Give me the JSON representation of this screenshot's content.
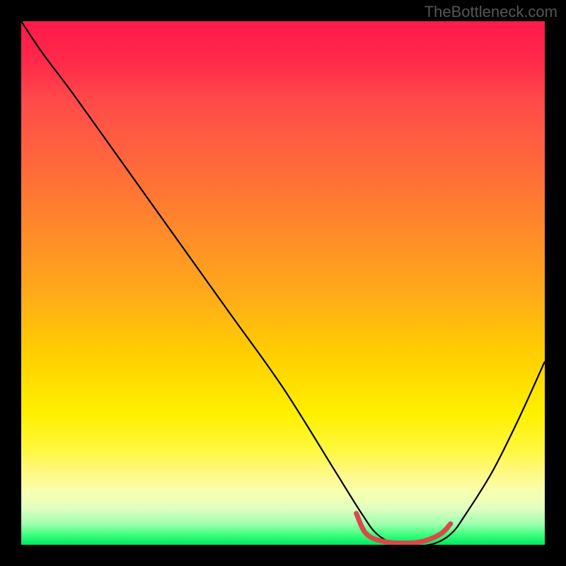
{
  "watermark": "TheBottleneck.com",
  "chart_data": {
    "type": "line",
    "title": "",
    "xlabel": "",
    "ylabel": "",
    "xlim": [
      0,
      100
    ],
    "ylim": [
      0,
      100
    ],
    "background": "heatmap-gradient",
    "gradient_stops": [
      {
        "pos": 0,
        "color": "#ff1a4a"
      },
      {
        "pos": 15,
        "color": "#ff4a4a"
      },
      {
        "pos": 40,
        "color": "#ff8a2a"
      },
      {
        "pos": 64,
        "color": "#ffd000"
      },
      {
        "pos": 82,
        "color": "#fff840"
      },
      {
        "pos": 93,
        "color": "#e0ffc0"
      },
      {
        "pos": 100,
        "color": "#00e860"
      }
    ],
    "series": [
      {
        "name": "curve",
        "color": "#000000",
        "x": [
          0,
          4,
          10,
          20,
          30,
          40,
          50,
          60,
          65,
          68,
          72,
          78,
          82,
          85,
          90,
          95,
          100
        ],
        "y": [
          100,
          94,
          86,
          72,
          58,
          44,
          30,
          14,
          6,
          2,
          0,
          0,
          2,
          6,
          14,
          24,
          35
        ]
      },
      {
        "name": "highlight-segment",
        "color": "#d84a4a",
        "thickness": 6,
        "x": [
          64,
          66,
          70,
          76,
          80,
          82
        ],
        "y": [
          6,
          2,
          0.5,
          0.5,
          2,
          4
        ]
      }
    ],
    "optimal_range_x": [
      66,
      80
    ]
  }
}
